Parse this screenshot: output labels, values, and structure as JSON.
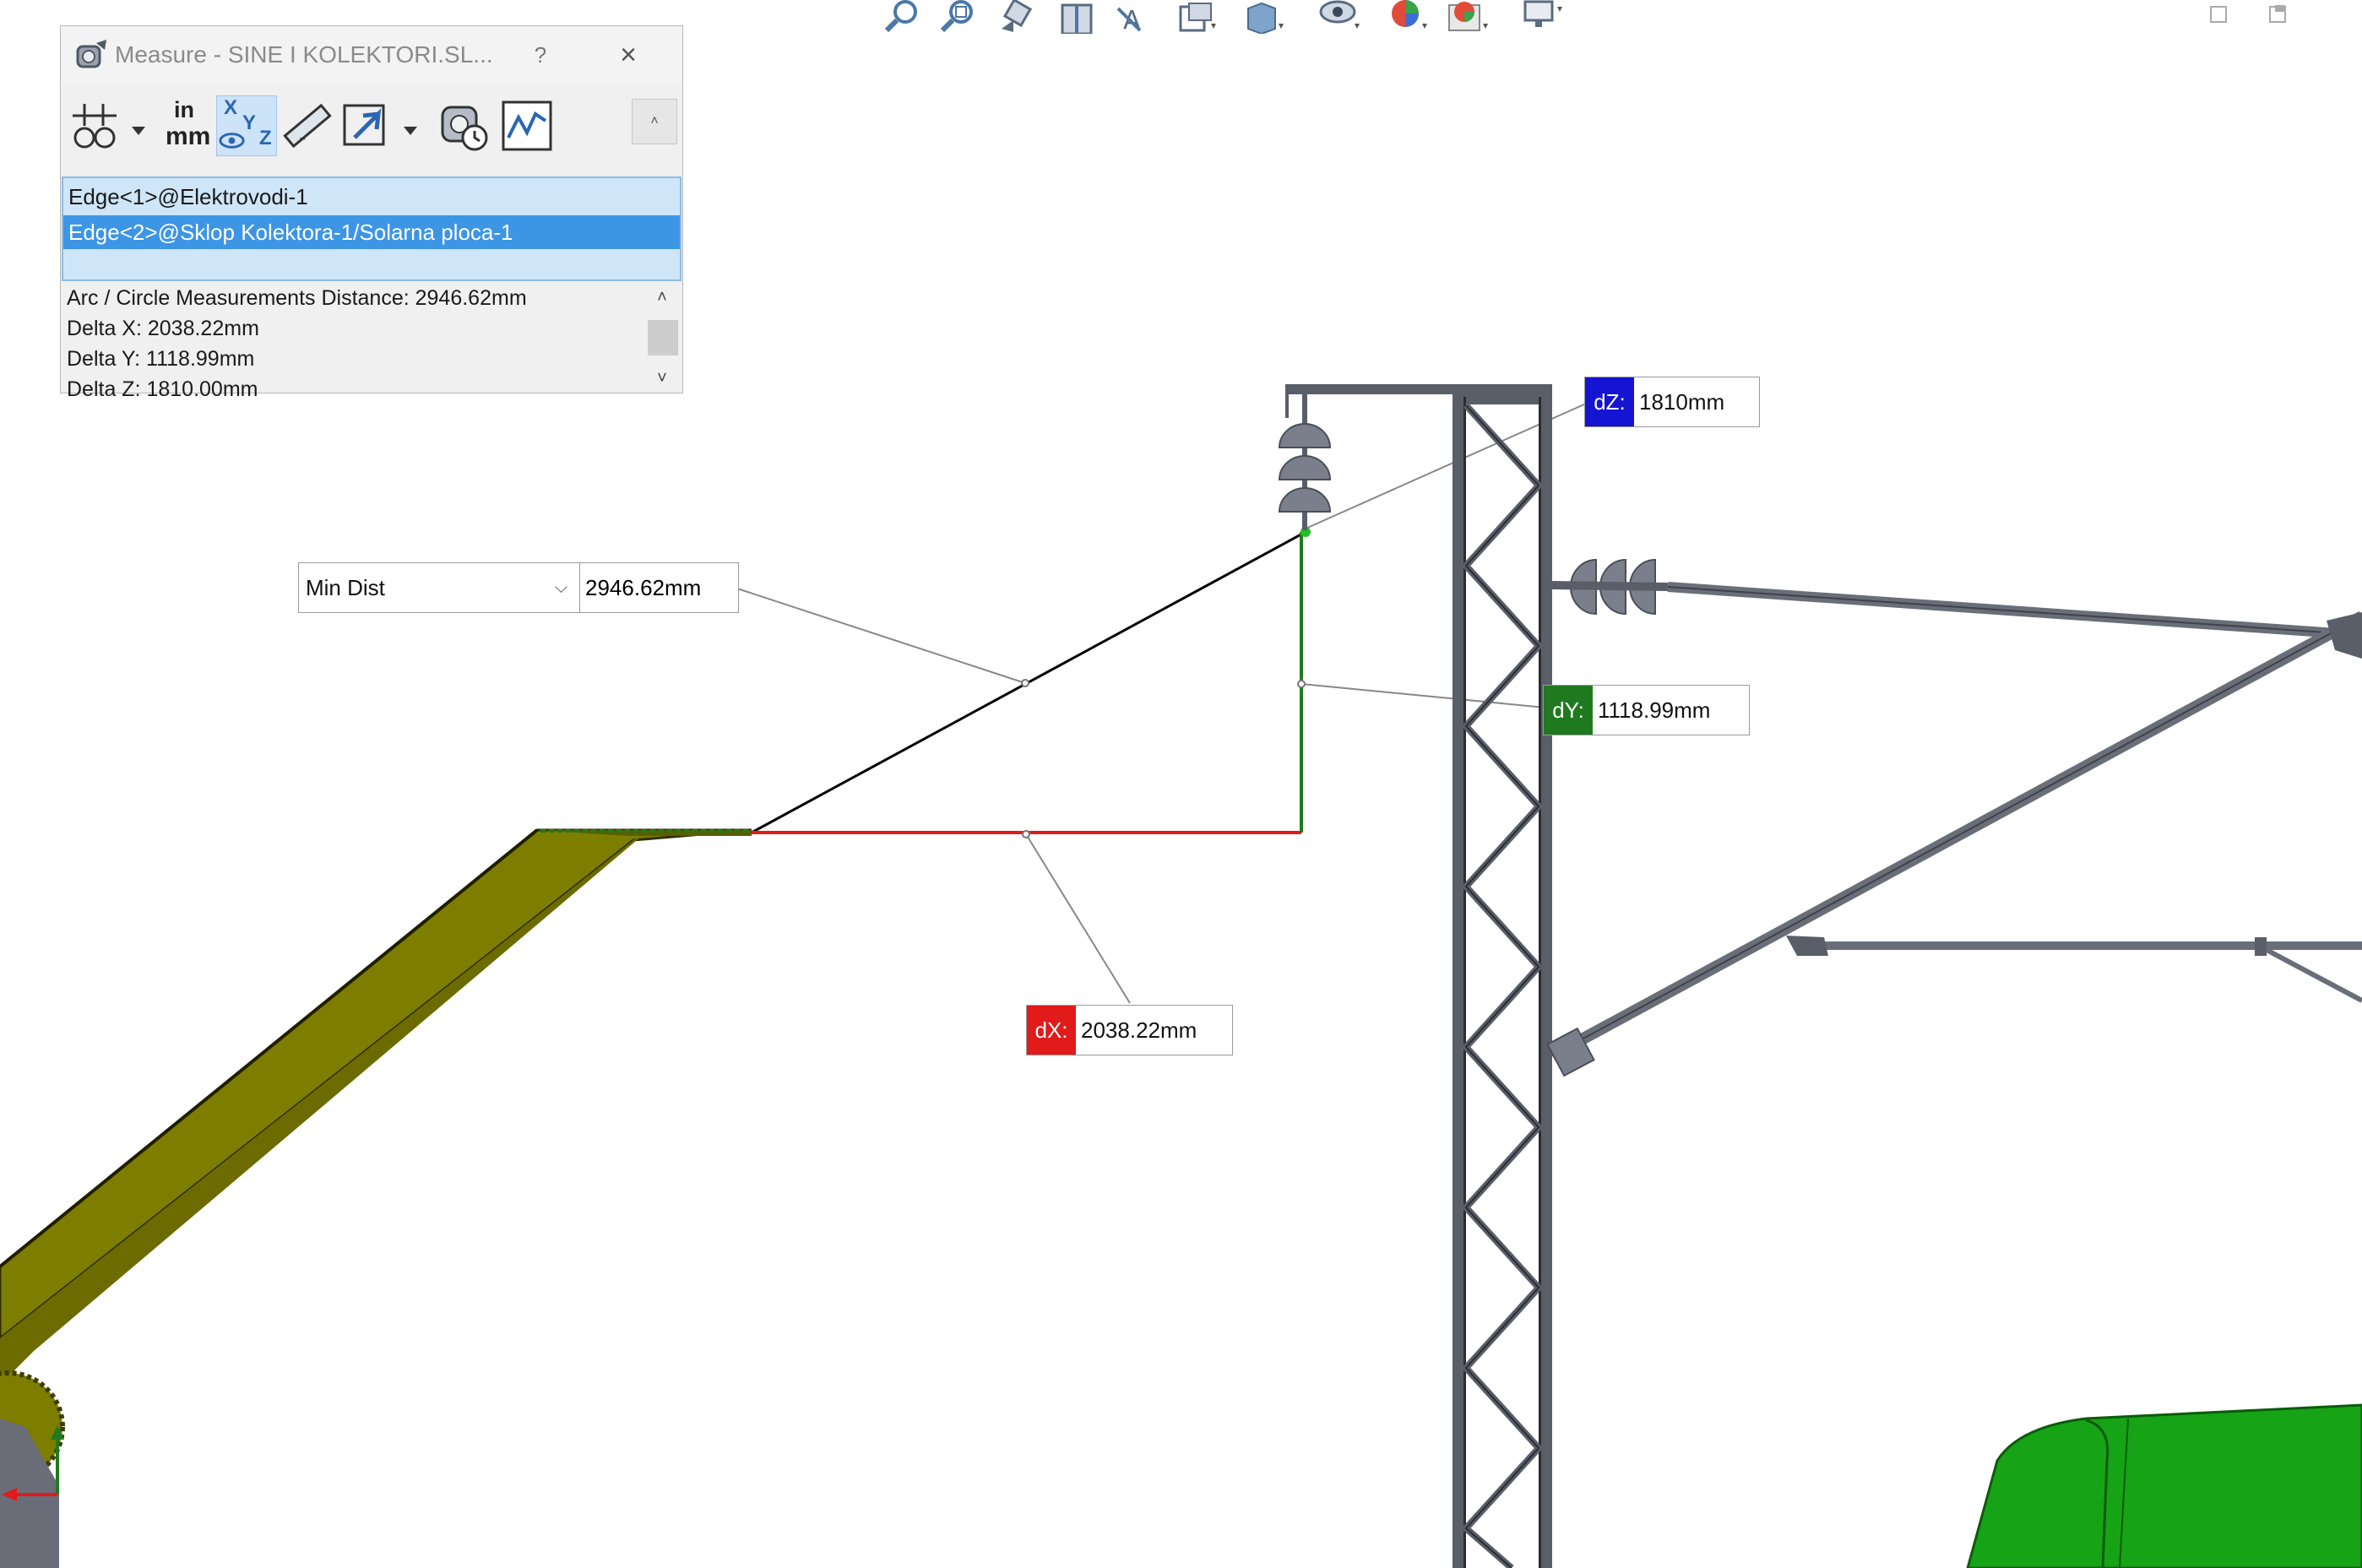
{
  "window": {
    "title": "Measure - SINE I KOLEKTORI.SL...",
    "help": "?",
    "close": "×"
  },
  "toolbar": {
    "units_top": "in",
    "units_bottom": "mm",
    "xyz_x": "X",
    "xyz_y": "Y",
    "xyz_z": "Z",
    "collapse": "˄"
  },
  "selections": [
    "Edge<1>@Elektrovodi-1",
    "Edge<2>@Sklop Kolektora-1/Solarna ploca-1"
  ],
  "results": [
    "Arc / Circle Measurements Distance: 2946.62mm",
    "Delta X: 2038.22mm",
    "Delta Y: 1118.99mm",
    "Delta Z: 1810.00mm"
  ],
  "scroll": {
    "up": "˄",
    "down": "˅"
  },
  "callouts": {
    "min_dist_label": "Min Dist",
    "min_dist_value": "2946.62mm",
    "dz_tag": "dZ:",
    "dz_value": "1810mm",
    "dy_tag": "dY:",
    "dy_value": "1118.99mm",
    "dx_tag": "dX:",
    "dx_value": "2038.22mm"
  },
  "colors": {
    "dx": "#e11a1a",
    "dy": "#1f7a1f",
    "dz": "#1414d2",
    "panel": "#7d7d00",
    "structure": "#5a5e68",
    "body": "#16a316",
    "selection": "#3d95e6"
  },
  "icons": {
    "hud": [
      "zoom-to-fit-icon",
      "zoom-area-icon",
      "previous-view-icon",
      "section-view-icon",
      "dynamic-annotation-icon",
      "view-orientation-icon",
      "display-style-icon",
      "hide-show-icon",
      "edit-appearance-icon",
      "apply-scene-icon",
      "view-settings-icon"
    ],
    "dialog": [
      "measure-icon",
      "arc-circle-options-icon",
      "units-precision-icon",
      "xyz-relative-icon",
      "point-to-point-icon",
      "projection-icon",
      "history-icon",
      "sensor-icon"
    ]
  }
}
